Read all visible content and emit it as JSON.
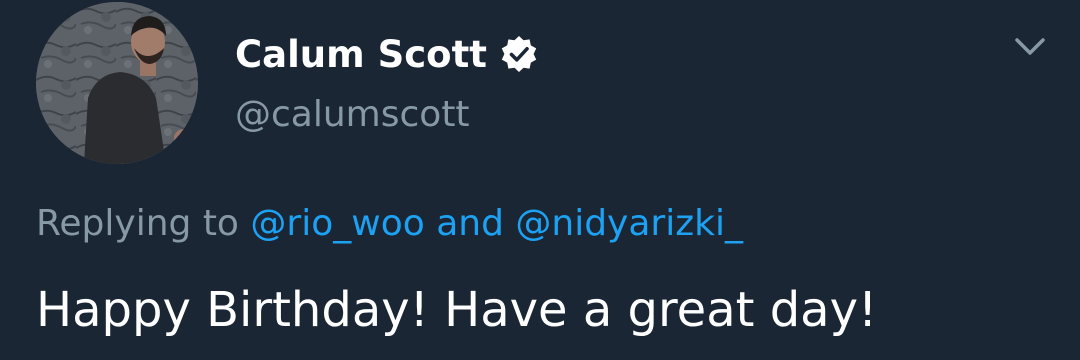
{
  "author": {
    "display_name": "Calum Scott",
    "handle": "@calumscott",
    "verified": true,
    "avatar_icon": "profile-photo"
  },
  "reply": {
    "prefix": "Replying to",
    "mention_1": "@rio_woo",
    "joiner": "and",
    "mention_2": "@nidyarizki_"
  },
  "tweet": {
    "text": "Happy Birthday! Have a great day!"
  },
  "icons": {
    "menu": "chevron-down-icon",
    "verified": "verified-badge-icon"
  },
  "colors": {
    "background": "#1b2635",
    "primary_text": "#ffffff",
    "secondary_text": "#8899a6",
    "link": "#1da1f2"
  }
}
